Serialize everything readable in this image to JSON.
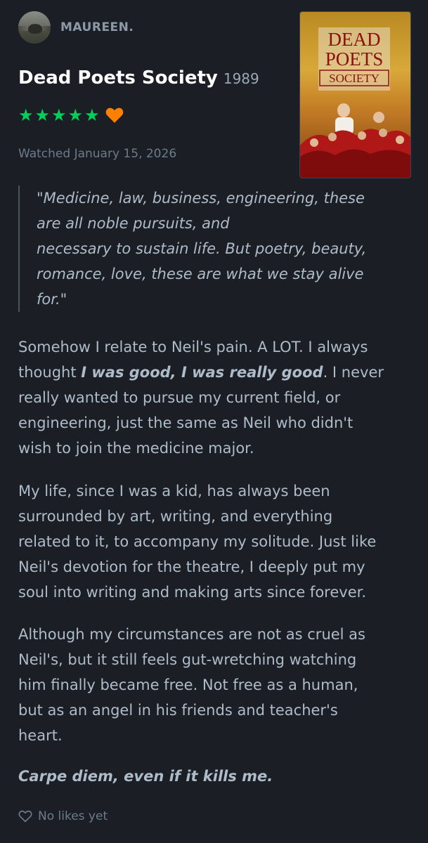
{
  "header": {
    "username": "MAUREEN."
  },
  "film": {
    "title": "Dead Poets Society",
    "year": "1989"
  },
  "rating": {
    "stars": 5,
    "max_stars": 5,
    "liked": true,
    "star_color": "#00d05a",
    "heart_color": "#ff8000"
  },
  "watched": "Watched January 15, 2026",
  "poster": {
    "title_lines": [
      "DEAD",
      "POETS",
      "SOCIETY"
    ]
  },
  "quote": {
    "lines": [
      "\"Medicine, law, business, engineering, these",
      "are all noble pursuits, and",
      "necessary to sustain life. But poetry, beauty,",
      "romance, love, these are what we stay alive",
      "for.\""
    ]
  },
  "review": {
    "p1": {
      "l1": "Somehow I relate to Neil's pain. A LOT. I always",
      "l2_pre": "thought ",
      "l2_emph": "I was good, I was really good",
      "l2_post": ". I never",
      "l3": "really wanted to pursue my current field, or",
      "l4": "engineering, just the same as Neil who didn't",
      "l5": "wish to join the medicine major."
    },
    "p2": [
      "My life, since I was a kid, has always been",
      "surrounded by art, writing, and everything",
      "related to it, to accompany my solitude. Just like",
      "Neil's devotion for the theatre, I deeply put my",
      "soul into writing and making arts since forever."
    ],
    "p3": [
      "Although my circumstances are not as cruel as",
      "Neil's, but it still feels gut-wretching watching",
      "him finally became free. Not free as a human,",
      "but as an angel in his friends and teacher's",
      "heart."
    ],
    "closing": "Carpe diem, even if it kills me."
  },
  "likes": {
    "label": "No likes yet",
    "icon": "heart-outline-icon"
  }
}
